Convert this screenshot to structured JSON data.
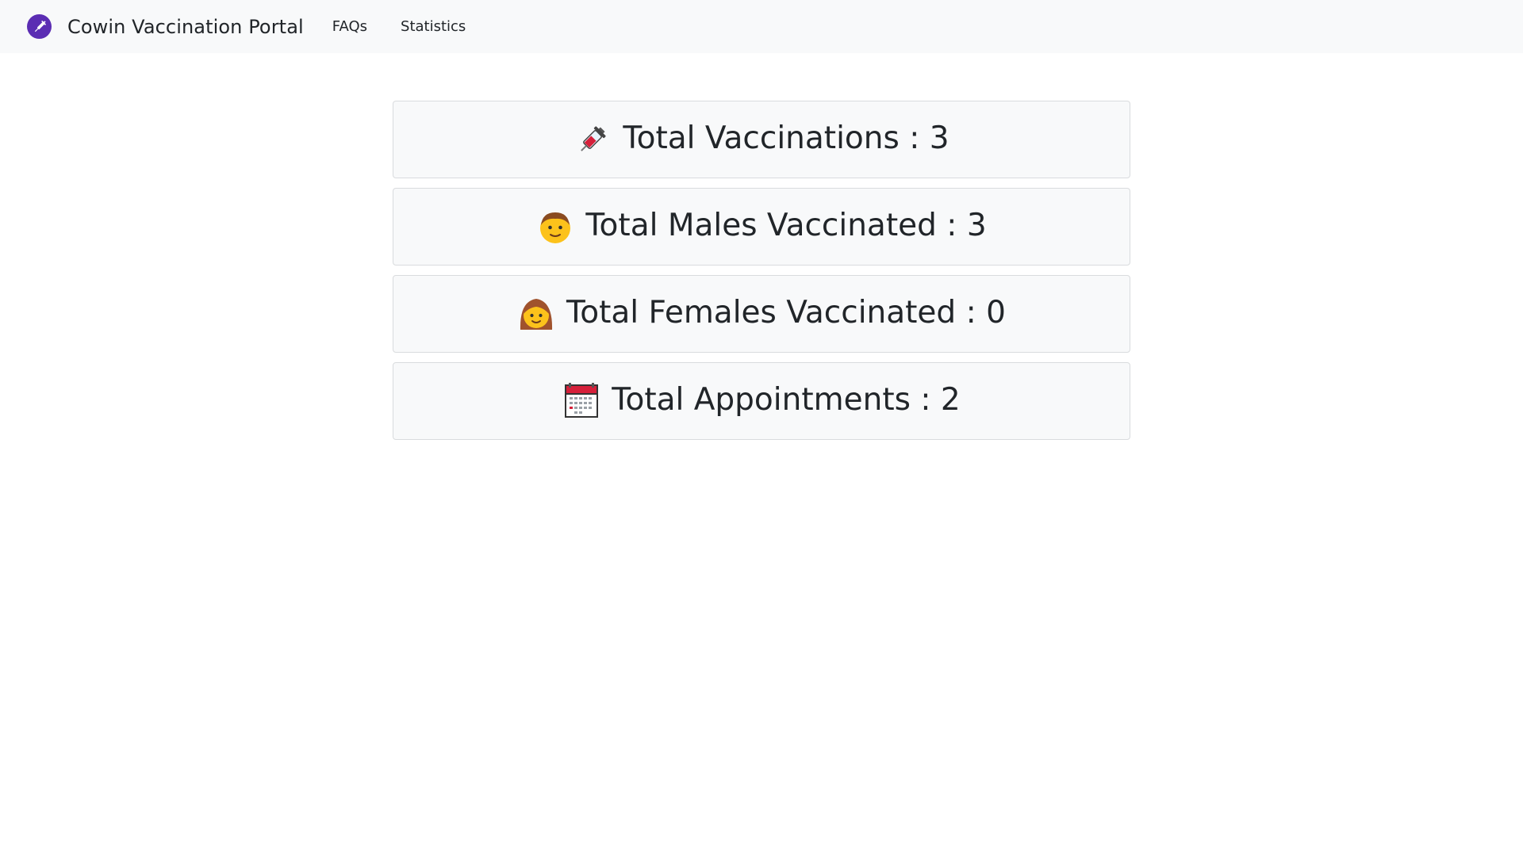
{
  "navbar": {
    "brand_title": "Cowin Vaccination Portal",
    "brand_icon": "syringe-logo-icon",
    "links": [
      {
        "label": "FAQs"
      },
      {
        "label": "Statistics"
      }
    ],
    "colors": {
      "background": "#f8f9fa",
      "logo": "#5b2db3"
    }
  },
  "stats": [
    {
      "icon": "syringe-icon",
      "label": "Total Vaccinations",
      "separator": " : ",
      "value": "3"
    },
    {
      "icon": "boy-face-icon",
      "label": "Total Males Vaccinated",
      "separator": " : ",
      "value": "3"
    },
    {
      "icon": "woman-face-icon",
      "label": "Total Females Vaccinated",
      "separator": " : ",
      "value": "0"
    },
    {
      "icon": "calendar-icon",
      "label": "Total Appointments",
      "separator": " : ",
      "value": "2"
    }
  ]
}
